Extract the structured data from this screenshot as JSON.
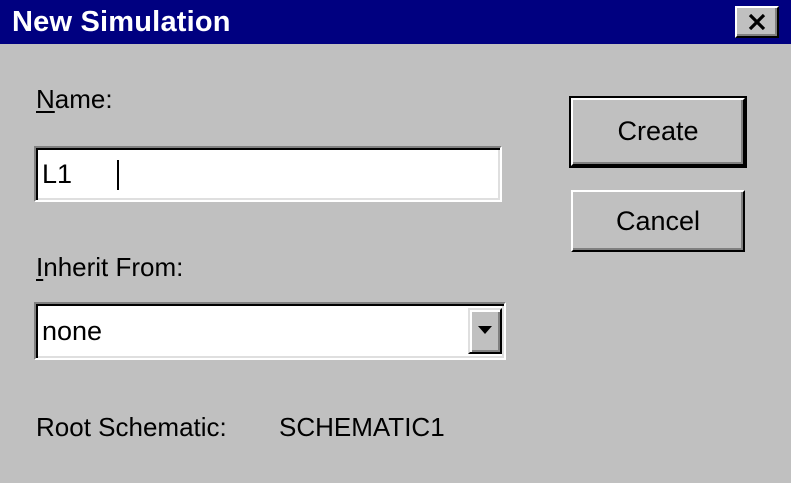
{
  "window": {
    "title": "New Simulation",
    "close_icon": "close-icon"
  },
  "name_field": {
    "label_mnemonic": "N",
    "label_rest": "ame:",
    "value": "L1"
  },
  "inherit_field": {
    "label_mnemonic": "I",
    "label_rest": "nherit From:",
    "selected": "none",
    "dropdown_icon": "chevron-down-icon"
  },
  "root_schematic": {
    "label": "Root Schematic:",
    "value": "SCHEMATIC1"
  },
  "buttons": {
    "create": "Create",
    "cancel": "Cancel"
  },
  "colors": {
    "titlebar": "#000080",
    "face": "#c0c0c0",
    "field": "#ffffff"
  }
}
